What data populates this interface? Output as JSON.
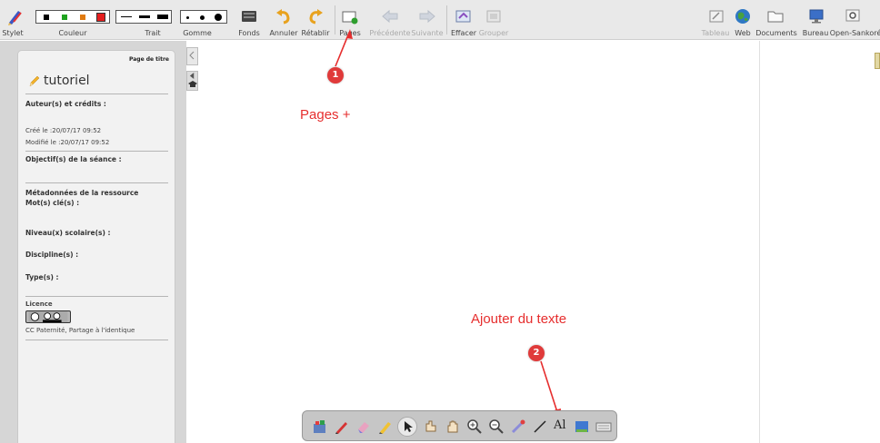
{
  "toolbar": {
    "stylet_label": "Stylet",
    "couleur_label": "Couleur",
    "trait_label": "Trait",
    "gomme_label": "Gomme",
    "fonds_label": "Fonds",
    "annuler_label": "Annuler",
    "retablir_label": "Rétablir",
    "pages_label": "Pages",
    "precedente_label": "Précédente",
    "suivante_label": "Suivante",
    "effacer_label": "Effacer",
    "grouper_label": "Grouper",
    "tableau_label": "Tableau",
    "web_label": "Web",
    "documents_label": "Documents",
    "bureau_label": "Bureau",
    "open_sankore_label": "Open-Sankoré",
    "colors": [
      "#000000",
      "#1fa31f",
      "#e07a10",
      "#e41e1e"
    ]
  },
  "side_panel": {
    "page_title_tag": "Page de titre",
    "doc_title": "tutoriel",
    "authors_label": "Auteur(s) et crédits :",
    "created": "Créé le :20/07/17 09:52",
    "modified": "Modifié le :20/07/17 09:52",
    "objectives_label": "Objectif(s) de la séance :",
    "metadata_label": "Métadonnées de la ressource",
    "keywords_label": "Mot(s) clé(s) :",
    "level_label": "Niveau(x) scolaire(s) :",
    "discipline_label": "Discipline(s) :",
    "type_label": "Type(s) :",
    "licence_label": "Licence",
    "licence_text": "CC Paternité, Partage à l'identique"
  },
  "annotations": {
    "badge1": "1",
    "text1": "Pages +",
    "badge2": "2",
    "text2": "Ajouter du texte",
    "color": "#e62e2e"
  },
  "float_toolbar": {
    "icons": [
      "widgets-icon",
      "pen-icon",
      "eraser-icon",
      "highlighter-icon",
      "pointer-icon",
      "interact-icon",
      "hand-icon",
      "zoom-in-icon",
      "zoom-out-icon",
      "laser-icon",
      "line-icon",
      "text-icon",
      "capture-icon",
      "keyboard-icon"
    ],
    "text_tool_label": "Al"
  }
}
